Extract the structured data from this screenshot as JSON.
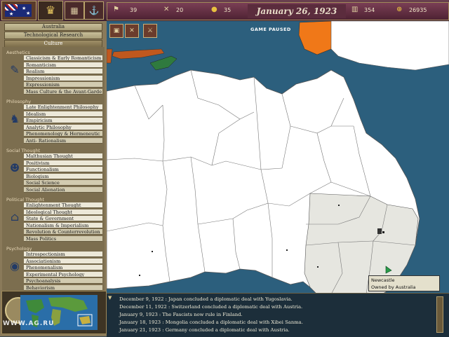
{
  "topbar": {
    "stats": [
      {
        "icon": "pop-icon",
        "glyph": "⚑",
        "value": "39"
      },
      {
        "icon": "military-icon",
        "glyph": "✕",
        "value": "20"
      },
      {
        "icon": "prestige-icon",
        "glyph": "●",
        "value": "35"
      },
      {
        "icon": "industry-icon",
        "glyph": "▥",
        "value": "354"
      },
      {
        "icon": "treasury-icon",
        "glyph": "⊛",
        "value": "26935"
      }
    ],
    "date": "January 26, 1923"
  },
  "leftpanel": {
    "country": "Australia",
    "tech_research": "Technological Research",
    "category": "Culture",
    "groups": [
      {
        "name": "Aesthetics",
        "icon": "painter-icon",
        "glyph": "✎",
        "items": [
          "Classicism & Early Romanticism",
          "Romanticism",
          "Realism",
          "Impressionism",
          "Expressionism",
          "Mass Culture & the Avant-Garde"
        ]
      },
      {
        "name": "Philosophy",
        "icon": "thinker-icon",
        "glyph": "♞",
        "items": [
          "Late Enlightenment Philosophy",
          "Idealism",
          "Empiricism",
          "Analytic Philosophy",
          "Phenomenology & Hermeneutic",
          "Anti- Rationalism"
        ]
      },
      {
        "name": "Social Thought",
        "icon": "people-icon",
        "glyph": "☻",
        "items": [
          "Malthusian Thought",
          "Positivism",
          "Functionalism",
          "Biologism",
          "Social Science",
          "Social Alienation"
        ]
      },
      {
        "name": "Political Thought",
        "icon": "parliament-icon",
        "glyph": "⌂",
        "items": [
          "Enlightenment Thought",
          "Ideological Thought",
          "State & Government",
          "Nationalism & Imperialism",
          "Revolution & Counterrevolution",
          "Mass Politics"
        ]
      },
      {
        "name": "Psychology",
        "icon": "mind-icon",
        "glyph": "◉",
        "items": [
          "Introspectionism",
          "Associationism",
          "Phenomenalism",
          "Experimental Psychology",
          "Psychoanalysis",
          "Behaviorism"
        ]
      }
    ],
    "watermark": "WWW.AG.RU"
  },
  "map": {
    "paused_label": "GAME PAUSED",
    "tooltip_line1": "Newcastle",
    "tooltip_line2": "Owned by Australia",
    "colors": {
      "sea": "#2c5f7d",
      "land": "#ffffff",
      "owned": "#e6e6e0",
      "enemy": "#f07818",
      "neighbor": "#2f7a3e"
    }
  },
  "log": [
    "December 9, 1922 : Japan concluded a diplomatic deal with Yugoslavia.",
    "December 11, 1922 : Switzerland concluded a diplomatic deal with Austria.",
    "January 9, 1923 : The Fascists now rule in Finland.",
    "January 18, 1923 : Mongolia concluded a diplomatic deal with Xibei Sanma.",
    "January 21, 1923 : Germany concluded a diplomatic deal with Austria."
  ]
}
